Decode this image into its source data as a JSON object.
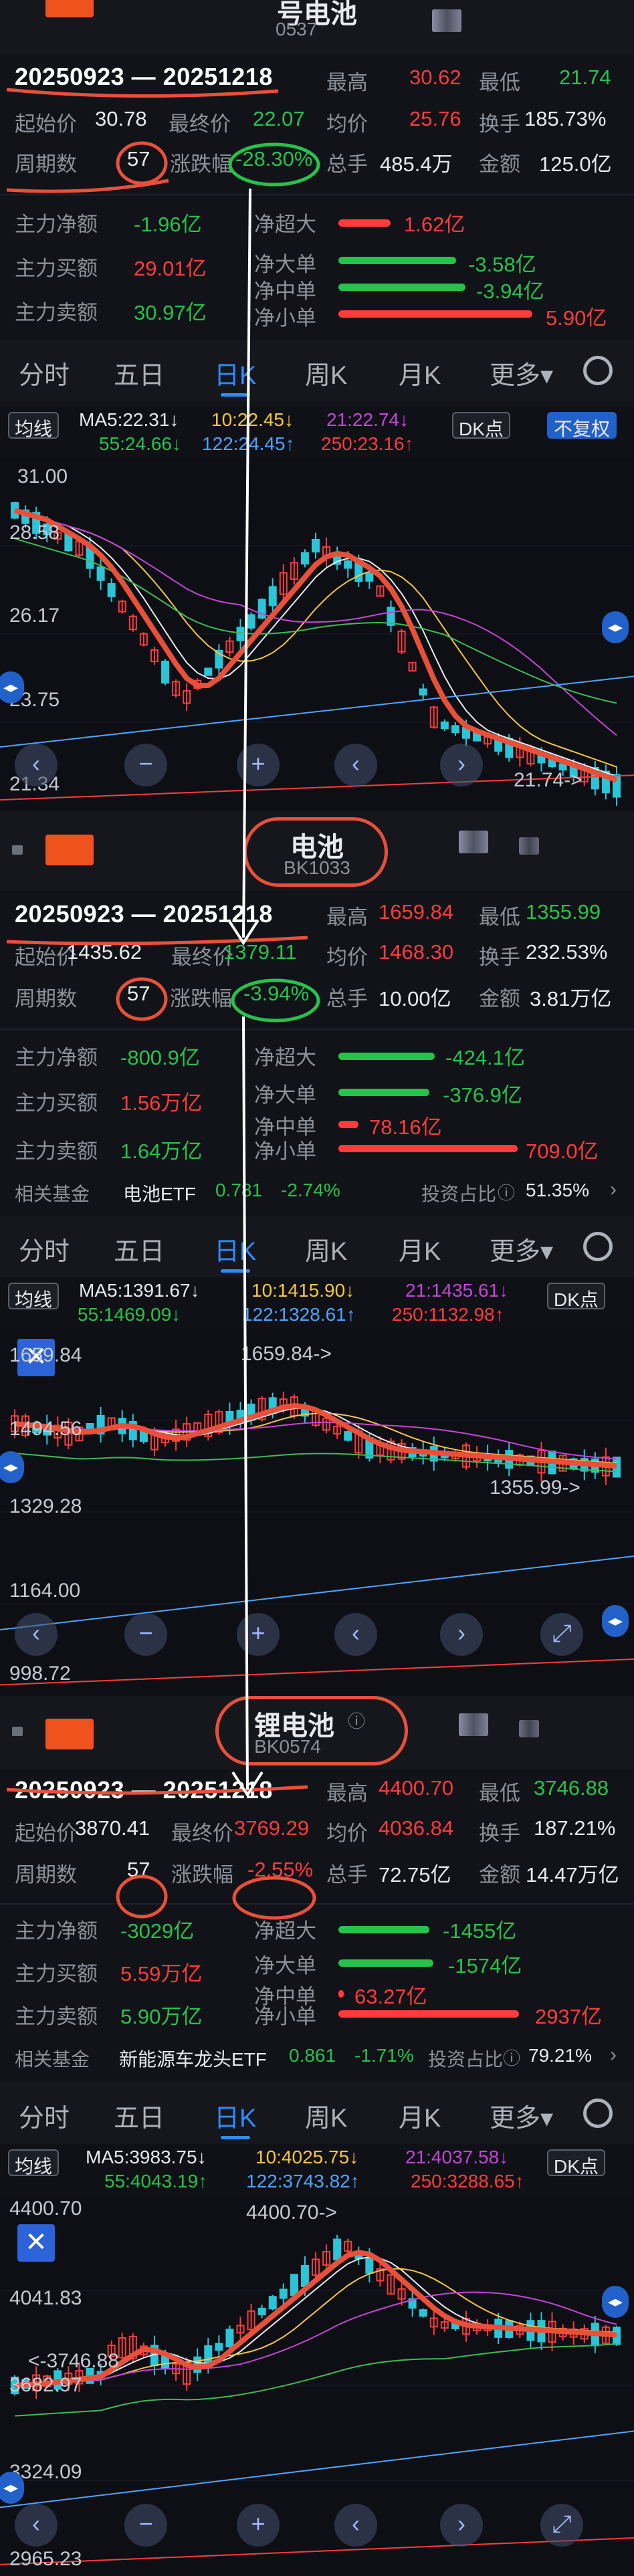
{
  "screens": [
    {
      "title": "号电池",
      "code": "0537",
      "period": "20250923 — 20251218",
      "stats": {
        "start_label": "起始价",
        "start": "30.78",
        "end_label": "最终价",
        "end": "22.07",
        "high_label": "最高",
        "high": "30.62",
        "low_label": "最低",
        "low": "21.74",
        "avg_label": "均价",
        "avg": "25.76",
        "turn_label": "换手",
        "turn": "185.73%",
        "days_label": "周期数",
        "days": "57",
        "chg_label": "涨跌幅",
        "chg": "-28.30%",
        "vol_label": "总手",
        "vol": "485.4万",
        "amt_label": "金额",
        "amt": "125.0亿"
      },
      "flows": {
        "net_label": "主力净额",
        "net": "-1.96亿",
        "buy_label": "主力买额",
        "buy": "29.01亿",
        "sell_label": "主力卖额",
        "sell": "30.97亿",
        "super_label": "净超大",
        "super": "1.62亿",
        "large_label": "净大单",
        "large": "-3.58亿",
        "mid_label": "净中单",
        "mid": "-3.94亿",
        "small_label": "净小单",
        "small": "5.90亿"
      },
      "tabs": [
        "分时",
        "五日",
        "日K",
        "周K",
        "月K",
        "更多▾"
      ],
      "indicators": {
        "mode": "均线",
        "ma5": "MA5:22.31↓",
        "ma10": "10:22.45↓",
        "ma21": "21:22.74↓",
        "ma55": "55:24.66↓",
        "ma122": "122:24.45↑",
        "ma250": "250:23.16↑",
        "dk": "DK点",
        "fq": "不复权"
      },
      "y_labels": [
        "31.00",
        "28.58",
        "26.17",
        "23.75",
        "21.34"
      ],
      "marker": "21.74->"
    },
    {
      "title": "电池",
      "code": "BK1033",
      "period": "20250923 — 20251218",
      "stats": {
        "start_label": "起始价",
        "start": "1435.62",
        "end_label": "最终价",
        "end": "1379.11",
        "high_label": "最高",
        "high": "1659.84",
        "low_label": "最低",
        "low": "1355.99",
        "avg_label": "均价",
        "avg": "1468.30",
        "turn_label": "换手",
        "turn": "232.53%",
        "days_label": "周期数",
        "days": "57",
        "chg_label": "涨跌幅",
        "chg": "-3.94%",
        "vol_label": "总手",
        "vol": "10.00亿",
        "amt_label": "金额",
        "amt": "3.81万亿"
      },
      "flows": {
        "net_label": "主力净额",
        "net": "-800.9亿",
        "buy_label": "主力买额",
        "buy": "1.56万亿",
        "sell_label": "主力卖额",
        "sell": "1.64万亿",
        "super_label": "净超大",
        "super": "-424.1亿",
        "large_label": "净大单",
        "large": "-376.9亿",
        "mid_label": "净中单",
        "mid": "78.16亿",
        "small_label": "净小单",
        "small": "709.0亿"
      },
      "fund": {
        "label": "相关基金",
        "name": "电池ETF",
        "price": "0.781",
        "chg": "-2.74%",
        "ratio_label": "投资占比",
        "ratio": "51.35%"
      },
      "tabs": [
        "分时",
        "五日",
        "日K",
        "周K",
        "月K",
        "更多▾"
      ],
      "indicators": {
        "mode": "均线",
        "ma5": "MA5:1391.67↓",
        "ma10": "10:1415.90↓",
        "ma21": "21:1435.61↓",
        "ma55": "55:1469.09↓",
        "ma122": "122:1328.61↑",
        "ma250": "250:1132.98↑",
        "dk": "DK点"
      },
      "y_labels": [
        "1659.84",
        "1494.56",
        "1329.28",
        "1164.00",
        "998.72"
      ],
      "marker_high": "1659.84->",
      "marker_low": "1355.99->"
    },
    {
      "title": "锂电池",
      "code": "BK0574",
      "period": "20250923 — 20251218",
      "stats": {
        "start_label": "起始价",
        "start": "3870.41",
        "end_label": "最终价",
        "end": "3769.29",
        "high_label": "最高",
        "high": "4400.70",
        "low_label": "最低",
        "low": "3746.88",
        "avg_label": "均价",
        "avg": "4036.84",
        "turn_label": "换手",
        "turn": "187.21%",
        "days_label": "周期数",
        "days": "57",
        "chg_label": "涨跌幅",
        "chg": "-2.55%",
        "vol_label": "总手",
        "vol": "72.75亿",
        "amt_label": "金额",
        "amt": "14.47万亿"
      },
      "flows": {
        "net_label": "主力净额",
        "net": "-3029亿",
        "buy_label": "主力买额",
        "buy": "5.59万亿",
        "sell_label": "主力卖额",
        "sell": "5.90万亿",
        "super_label": "净超大",
        "super": "-1455亿",
        "large_label": "净大单",
        "large": "-1574亿",
        "mid_label": "净中单",
        "mid": "63.27亿",
        "small_label": "净小单",
        "small": "2937亿"
      },
      "fund": {
        "label": "相关基金",
        "name": "新能源车龙头ETF",
        "price": "0.861",
        "chg": "-1.71%",
        "ratio_label": "投资占比",
        "ratio": "79.21%"
      },
      "tabs": [
        "分时",
        "五日",
        "日K",
        "周K",
        "月K",
        "更多▾"
      ],
      "indicators": {
        "mode": "均线",
        "ma5": "MA5:3983.75↓",
        "ma10": "10:4025.75↓",
        "ma21": "21:4037.58↓",
        "ma55": "55:4043.19↑",
        "ma122": "122:3743.82↑",
        "ma250": "250:3288.65↑",
        "dk": "DK点"
      },
      "y_labels": [
        "4400.70",
        "4041.83",
        "3682.97",
        "3324.09",
        "2965.23"
      ],
      "marker_high": "4400.70->",
      "marker_low": "<-3746.88"
    }
  ],
  "colors": {
    "up": "#ff3b3b",
    "down": "#27c24c",
    "accent": "#2d8cff",
    "annotation": "#e8503a"
  }
}
